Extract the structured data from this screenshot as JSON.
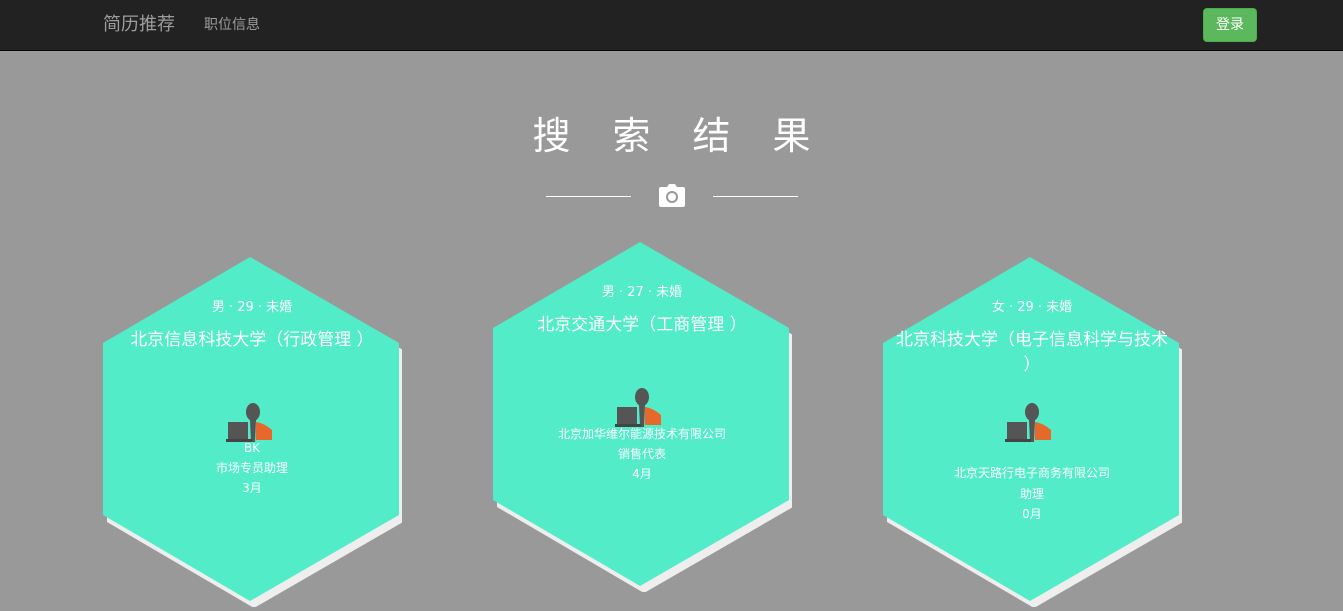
{
  "navbar": {
    "brand": "简历推荐",
    "nav_link": "职位信息",
    "login_label": "登录"
  },
  "heading": {
    "title": "搜索结果",
    "icon": "camera-icon"
  },
  "colors": {
    "page_bg": "#999999",
    "navbar_bg": "#222222",
    "hex_fill": "#52ecc8",
    "hex_shadow": "#eeeeee",
    "login_bg": "#5cb85c",
    "icon_head": "#555555",
    "icon_jacket": "#e6682a"
  },
  "cards": [
    {
      "meta": "男 · 29 · 未婚",
      "school": "北京信息科技大学（行政管理 ）",
      "icon": "person-laptop-icon",
      "lines": [
        "BK",
        "市场专员助理",
        "3月"
      ]
    },
    {
      "meta": "男 · 27 · 未婚",
      "school": "北京交通大学（工商管理 ）",
      "icon": "person-laptop-icon",
      "lines": [
        "北京加华维尔能源技术有限公司",
        "销售代表",
        "4月"
      ]
    },
    {
      "meta": "女 · 29 · 未婚",
      "school": "北京科技大学（电子信息科学与技术 ）",
      "icon": "person-laptop-icon",
      "lines": [
        "北京天路行电子商务有限公司",
        "助理",
        "0月"
      ]
    }
  ]
}
